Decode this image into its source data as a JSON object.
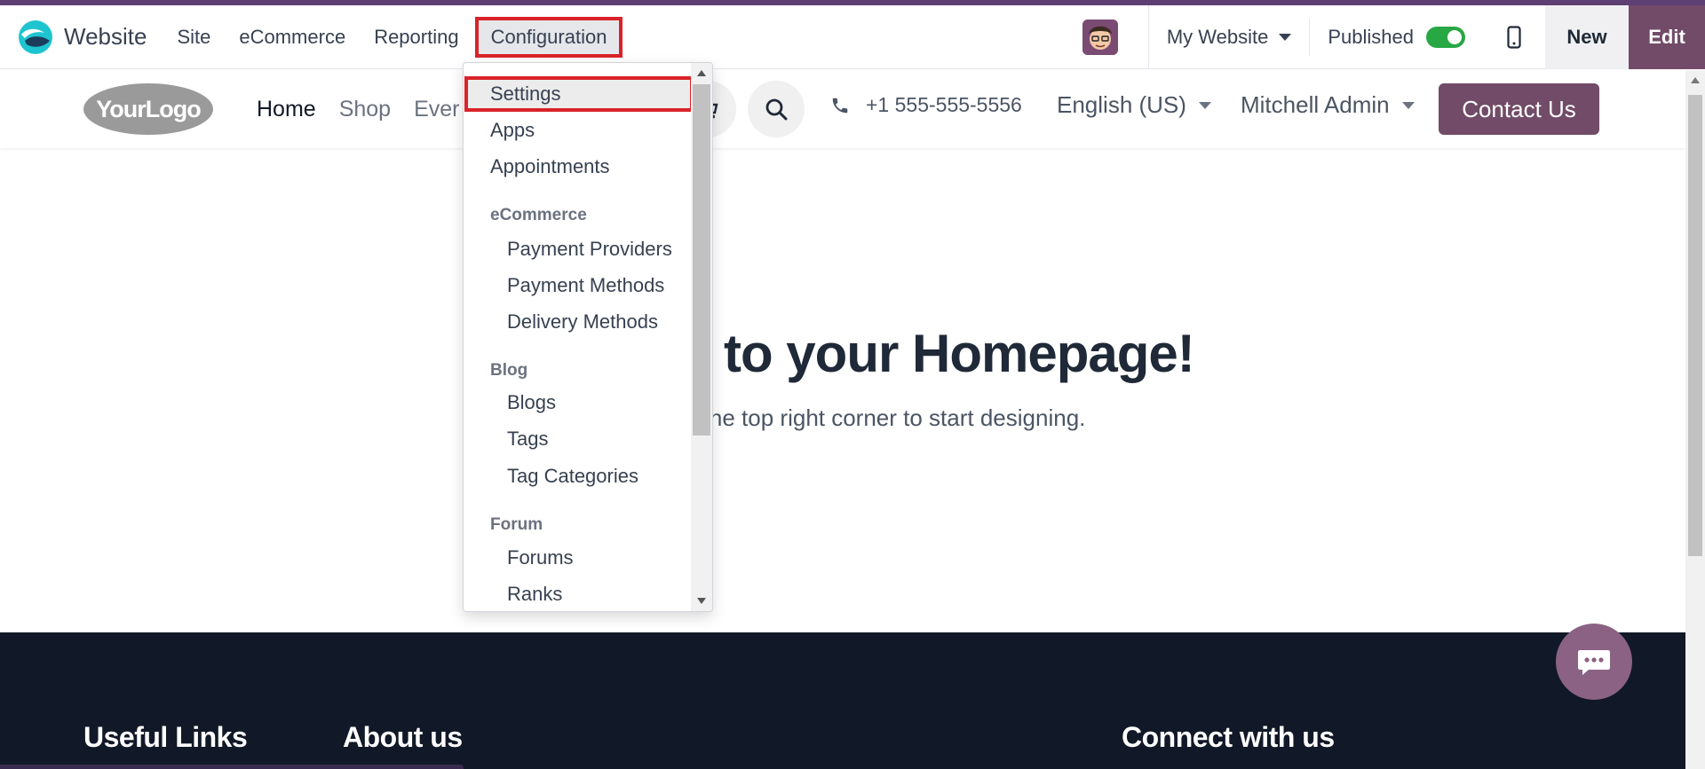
{
  "colors": {
    "accent_purple": "#714b67",
    "toggle_green": "#28a745",
    "highlight_red": "#d92328",
    "footer_bg": "#111827"
  },
  "topbar": {
    "app_icon": "odoo-website-app-icon",
    "app_name": "Website",
    "menu": [
      "Site",
      "eCommerce",
      "Reporting",
      "Configuration"
    ],
    "active_menu": "Configuration",
    "avatar_icon": "user-avatar-icon",
    "website_selector": "My Website",
    "published_label": "Published",
    "published": true,
    "mobile_icon": "mobile-phone-icon",
    "new_label": "New",
    "edit_label": "Edit"
  },
  "configuration_menu": {
    "selected": "Settings",
    "top_items": [
      "Settings",
      "Apps",
      "Appointments"
    ],
    "ecommerce_header": "eCommerce",
    "ecommerce_items": [
      "Payment Providers",
      "Payment Methods",
      "Delivery Methods"
    ],
    "blog_header": "Blog",
    "blog_items": [
      "Blogs",
      "Tags",
      "Tag Categories"
    ],
    "forum_header": "Forum",
    "forum_items": [
      "Forums",
      "Ranks"
    ]
  },
  "site": {
    "logo_text": "YourLogo",
    "nav": [
      "Home",
      "Shop",
      "Ever"
    ],
    "current_nav": "Home",
    "search_icon": "search-icon",
    "cart_icon": "cart-icon",
    "phone_icon": "phone-icon",
    "phone": "+1 555-555-5556",
    "language": "English (US)",
    "user": "Mitchell Admin",
    "contact_label": "Contact Us",
    "hero_title_part1": "to your",
    "hero_title_part2": "Homepage!",
    "hero_subtitle": "n the top right corner to start designing.",
    "footer_headings": [
      "Useful Links",
      "About us",
      "Connect with us"
    ],
    "chat_icon": "chat-bubble-icon"
  }
}
